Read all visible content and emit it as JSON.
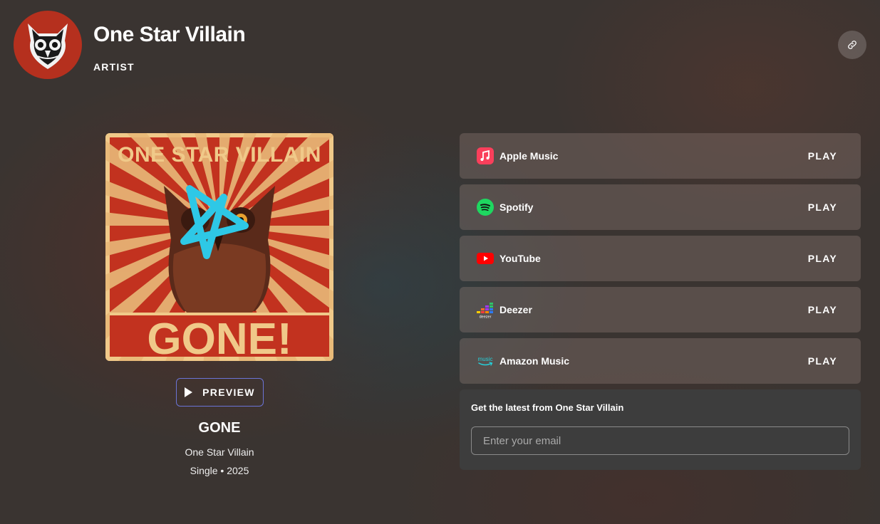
{
  "header": {
    "artist_name": "One Star Villain",
    "artist_role": "ARTIST",
    "avatar_icon": "owl-logo-icon",
    "link_icon": "link-icon"
  },
  "album": {
    "cover_top_text": "ONE STAR VILLAIN",
    "cover_bottom_text": "GONE!",
    "preview_label": "PREVIEW",
    "title": "GONE",
    "artist": "One Star Villain",
    "meta": "Single • 2025"
  },
  "services": [
    {
      "name": "Apple Music",
      "action": "PLAY",
      "icon": "apple-music-icon",
      "color": "#fa3f5b"
    },
    {
      "name": "Spotify",
      "action": "PLAY",
      "icon": "spotify-icon",
      "color": "#1ed760"
    },
    {
      "name": "YouTube",
      "action": "PLAY",
      "icon": "youtube-icon",
      "color": "#ff0000"
    },
    {
      "name": "Deezer",
      "action": "PLAY",
      "icon": "deezer-icon",
      "color": "#a238ff"
    },
    {
      "name": "Amazon Music",
      "action": "PLAY",
      "icon": "amazon-music-icon",
      "color": "#25d1da"
    }
  ],
  "signup": {
    "title": "Get the latest from One Star Villain",
    "email_placeholder": "Enter your email",
    "email_value": ""
  },
  "colors": {
    "avatar_bg": "#b5301e",
    "preview_border": "#6b74d6",
    "cover_red": "#c2321f",
    "cover_cream": "#f0c989",
    "star_cyan": "#2ec8e6"
  }
}
